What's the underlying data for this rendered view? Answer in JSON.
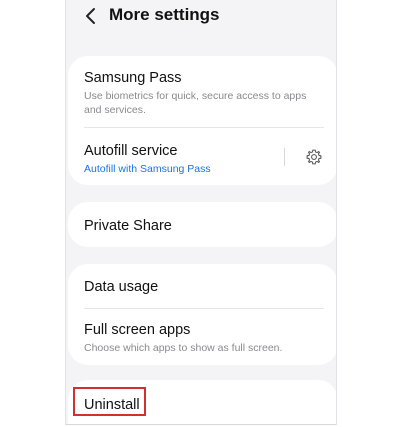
{
  "header": {
    "title": "More settings",
    "back_icon": "chevron-left-icon"
  },
  "sections": {
    "samsung_pass": {
      "title": "Samsung Pass",
      "subtitle": "Use biometrics for quick, secure access to apps and services."
    },
    "autofill": {
      "title": "Autofill service",
      "subtitle": "Autofill with Samsung Pass",
      "action_icon": "gear-icon"
    },
    "private_share": {
      "title": "Private Share"
    },
    "data_usage": {
      "title": "Data usage"
    },
    "full_screen_apps": {
      "title": "Full screen apps",
      "subtitle": "Choose which apps to show as full screen."
    },
    "uninstall": {
      "title": "Uninstall"
    }
  },
  "colors": {
    "background": "#f4f4f6",
    "card": "#ffffff",
    "accent_link": "#1a73e8",
    "highlight_box": "#d32f2f"
  }
}
